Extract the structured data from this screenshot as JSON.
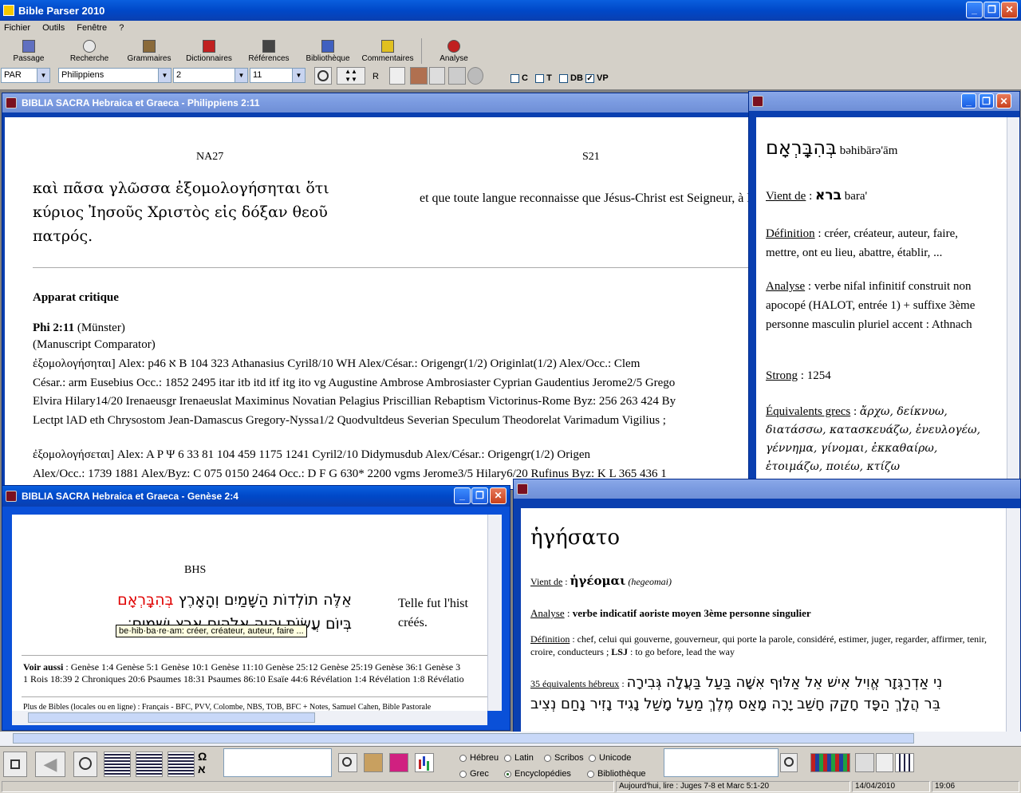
{
  "app": {
    "title": "Bible Parser 2010"
  },
  "menu": [
    "Fichier",
    "Outils",
    "Fenêtre",
    "?"
  ],
  "toolbar": [
    "Passage",
    "Recherche",
    "Grammaires",
    "Dictionnaires",
    "Références",
    "Bibliothèque",
    "Commentaires",
    "Analyse"
  ],
  "nav": {
    "version": "PAR",
    "book": "Philippiens",
    "chapter": "2",
    "verse": "11",
    "r_label": "R",
    "checks": [
      {
        "label": "C",
        "checked": false
      },
      {
        "label": "T",
        "checked": false
      },
      {
        "label": "DB",
        "checked": false
      },
      {
        "label": "VP",
        "checked": true
      }
    ]
  },
  "win1": {
    "title": "BIBLIA SACRA Hebraica et Graeca - Philippiens 2:11",
    "col1_head": "NA27",
    "col2_head": "S21",
    "greek": "καὶ πᾶσα γλῶσσα ἐξομολογήσηται ὅτι κύριος Ἰησοῦς Χριστὸς εἰς δόξαν θεοῦ πατρός.",
    "french": "et que toute langue reconnaisse que Jésus-Christ est Seigneur, à la gloire de Dieu le Père.",
    "apparat_title": "Apparat critique",
    "ref": "Phi 2:11",
    "ref_paren": "(Münster)",
    "comparator": "(Manuscript Comparator)",
    "lines": [
      "ἐξομολογήσηται]  Alex: p46 א B 104 323 Athanasius Cyril8/10 WH Alex/César.: Origengr(1/2) Originlat(1/2) Alex/Occ.: Clem",
      "César.: arm Eusebius Occ.: 1852 2495 itar itb itd itf itg ito vg Augustine Ambrose Ambrosiaster Cyprian Gaudentius Jerome2/5 Grego",
      "Elvira Hilary14/20 Irenaeusgr Irenaeuslat Maximinus Novatian Pelagius Priscillian Rebaptism Victorinus-Rome Byz: 256 263 424 By",
      "Lectpt lAD eth Chrysostom Jean-Damascus Gregory-Nyssa1/2 Quodvultdeus Severian Speculum Theodorelat Varimadum Vigilius ;",
      "ἐξομολογήσεται]  Alex: A P Ψ 6 33 81 104 459 1175 1241 Cyril2/10 Didymusdub Alex/César.: Origengr(1/2) Origen",
      "Alex/Occ.: 1739 1881 Alex/Byz: C 075 0150 2464 Occ.: D F G 630* 2200 vgms Jerome3/5 Hilary6/20 Rufinus Byz: K L 365 436 1"
    ]
  },
  "win2": {
    "head": "בְּהִבָּֽרְאָם",
    "translit": "bəhibārə'ām",
    "vient_label": "Vient de",
    "vient": "ברא",
    "vient_tr": "bara'",
    "def_label": "Définition",
    "def": "créer, créateur, auteur, faire, mettre, ont eu lieu, abattre, établir, ...",
    "an_label": "Analyse",
    "an": "verbe nifal infinitif construit non apocopé (HALOT, entrée 1) + suffixe 3ème personne masculin pluriel accent : Athnach",
    "strong_label": "Strong",
    "strong": "1254",
    "eq_label": "Équivalents grecs",
    "eq": "ἄρχω, δείκνυω, διατάσσω, κατασκευάζω, ἐνευλογέω, γέννημα, γίνομαι, ἐκκαθαίρω, ἑτοιμάζω, ποιέω, κτίζω"
  },
  "win3": {
    "title": "BIBLIA SACRA Hebraica et Graeca - Genèse 2:4",
    "col_head": "BHS",
    "heb1": "אֵלֶּה תוֹלְדוֹת הַשָּׁמַיִם וְהָאָרֶץ",
    "heb_red": "בְּהִבָּֽרְאָם",
    "heb2": "בְּיוֹם עֲשׂוֹת יְהוָה אֱלֹהִים אֶרֶץ וְשָׁמָיִם׃",
    "fr": "Telle fut l'hist créés.",
    "tooltip": "be·hib·ba·re·am: créer, créateur, auteur, faire ...",
    "voir_label": "Voir aussi",
    "voir": "Genèse 1:4 Genèse 5:1 Genèse 10:1 Genèse 11:10 Genèse 25:12 Genèse 25:19 Genèse 36:1 Genèse 3",
    "voir2": "1 Rois 18:39 2 Chroniques 20:6 Psaumes 18:31 Psaumes 86:10 Esaïe 44:6 Révélation 1:4 Révélation 1:8 Révélatio",
    "more": "Plus de Bibles (locales ou en ligne) : Français - BFC, PVV, Colombe, NBS, TOB, BFC + Notes, Samuel Cahen, Bible Pastorale"
  },
  "win4": {
    "head": "ἡγήσατο",
    "vient_label": "Vient de",
    "vient": "ἡγέομαι",
    "vient_tr": "(hegeomai)",
    "an_label": "Analyse",
    "an": "verbe indicatif aoriste moyen 3ème personne singulier",
    "def_label": "Définition",
    "def": "chef, celui qui gouverne, gouverneur, qui porte la parole, considéré, estimer, juger, regarder, affirmer, tenir, croire, conducteurs ;",
    "lsj": "LSJ",
    "lsj_def": "to go before, lead the way",
    "eq_label": "35 équivalents hébreux",
    "eq1": "נִי אַדְרַגְּזָר אֱוִיל אִישׁ אֵל אַלּוּף אִשָּׁה בַּעַל בַּעֲלָה גְּבִירָה",
    "eq2": "בֵּר הֲלָךְ הַפָּד חָקַק חָשַׁב יָרָה מָאַס מֶלֶךְ מַעַל מָשַׁל נָגִיד נָזִיר נָחַם נְצִיב"
  },
  "bottom": {
    "radios": [
      {
        "label": "Hébreu",
        "on": false
      },
      {
        "label": "Latin",
        "on": false
      },
      {
        "label": "Scribos",
        "on": false
      },
      {
        "label": "Unicode",
        "on": false
      },
      {
        "label": "Grec",
        "on": false
      },
      {
        "label": "Encyclopédies",
        "on": true
      },
      {
        "label": "Bibliothèque",
        "on": false
      }
    ]
  },
  "status": {
    "reading": "Aujourd'hui, lire : Juges 7-8 et Marc 5:1-20",
    "date": "14/04/2010",
    "time": "19:06"
  }
}
